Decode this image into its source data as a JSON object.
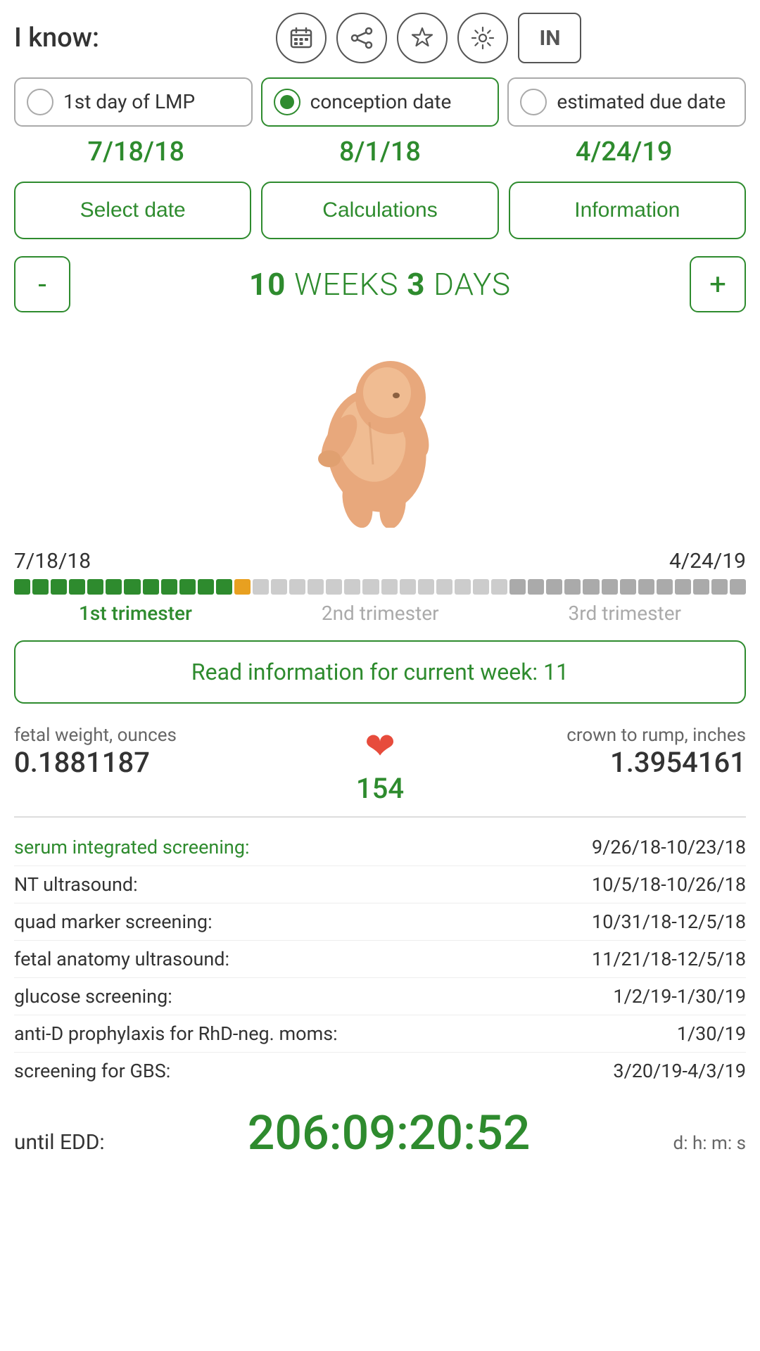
{
  "app": {
    "i_know_label": "I know:",
    "in_button_label": "IN"
  },
  "icons": {
    "calendar": "📅",
    "share": "⬆",
    "star": "☆",
    "settings": "⚙"
  },
  "radio_options": [
    {
      "id": "lmp",
      "label": "1st day of LMP",
      "selected": false
    },
    {
      "id": "conception",
      "label": "conception date",
      "selected": true
    },
    {
      "id": "due_date",
      "label": "estimated due date",
      "selected": false
    }
  ],
  "dates": {
    "lmp": "7/18/18",
    "conception": "8/1/18",
    "due": "4/24/19"
  },
  "buttons": {
    "select_date": "Select date",
    "calculations": "Calculations",
    "information": "Information"
  },
  "weeks": {
    "weeks_num": "10",
    "weeks_label": "WEEKS",
    "days_num": "3",
    "days_label": "DAYS",
    "minus": "-",
    "plus": "+"
  },
  "timeline": {
    "start_date": "7/18/18",
    "end_date": "4/24/19",
    "segments": {
      "green_filled": 12,
      "orange": 1,
      "gray_light": 14,
      "gray": 13
    },
    "labels": {
      "first": "1st trimester",
      "second": "2nd trimester",
      "third": "3rd trimester"
    }
  },
  "read_info": {
    "label": "Read information for current week: 11"
  },
  "stats": {
    "fetal_weight_label": "fetal weight, ounces",
    "fetal_weight_value": "0.1881187",
    "heart_count": "154",
    "crown_rump_label": "crown to rump, inches",
    "crown_rump_value": "1.3954161"
  },
  "screenings": [
    {
      "label": "serum integrated screening:",
      "is_green": true,
      "date": "9/26/18-10/23/18"
    },
    {
      "label": "NT ultrasound:",
      "is_green": false,
      "date": "10/5/18-10/26/18"
    },
    {
      "label": "quad marker screening:",
      "is_green": false,
      "date": "10/31/18-12/5/18"
    },
    {
      "label": "fetal anatomy ultrasound:",
      "is_green": false,
      "date": "11/21/18-12/5/18"
    },
    {
      "label": "glucose screening:",
      "is_green": false,
      "date": "1/2/19-1/30/19"
    },
    {
      "label": "anti-D prophylaxis for RhD-neg. moms:",
      "is_green": false,
      "date": "1/30/19"
    },
    {
      "label": "screening for GBS:",
      "is_green": false,
      "date": "3/20/19-4/3/19"
    }
  ],
  "edd": {
    "until_label": "until EDD:",
    "countdown": "206:09:20:52",
    "dhms": "d: h: m: s"
  }
}
